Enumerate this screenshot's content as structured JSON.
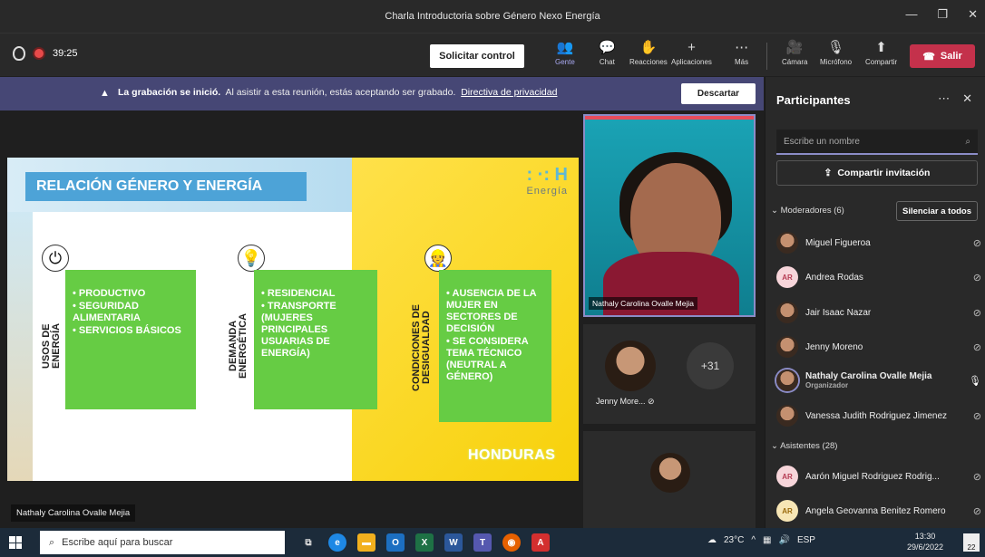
{
  "window": {
    "title": "Charla Introductoria sobre Género Nexo Energía",
    "minimize": "—",
    "restore": "❐",
    "close": "✕"
  },
  "toolbar": {
    "timer": "39:25",
    "request_control": "Solicitar control",
    "items": [
      {
        "label": "Gente",
        "icon": "people-icon",
        "glyph": "👥"
      },
      {
        "label": "Chat",
        "icon": "chat-icon",
        "glyph": "💬"
      },
      {
        "label": "Reacciones",
        "icon": "reactions-icon",
        "glyph": "✋"
      },
      {
        "label": "Aplicaciones",
        "icon": "plus-icon",
        "glyph": "+"
      },
      {
        "label": "Más",
        "icon": "more-icon",
        "glyph": "⋯"
      },
      {
        "label": "Cámara",
        "icon": "camera-off-icon",
        "glyph": "🎥"
      },
      {
        "label": "Micrófono",
        "icon": "mic-off-icon",
        "glyph": "🎙"
      },
      {
        "label": "Compartir",
        "icon": "share-icon",
        "glyph": "⬆"
      }
    ],
    "leave_label": "Salir"
  },
  "banner": {
    "bold": "La grabación se inició.",
    "text": "Al asistir a esta reunión, estás aceptando ser grabado.",
    "link": "Directiva de privacidad",
    "dismiss": "Descartar"
  },
  "slide": {
    "title": "RELACIÓN GÉNERO Y ENERGÍA",
    "logo_h": ": ·: H",
    "logo_sub": "Energía",
    "columns": [
      {
        "vlabel_1": "USOS DE",
        "vlabel_2": "ENERGÍA",
        "items": [
          "PRODUCTIVO",
          "SEGURIDAD ALIMENTARIA",
          "SERVICIOS BÁSICOS"
        ]
      },
      {
        "vlabel_1": "DEMANDA",
        "vlabel_2": "ENERGÉTICA",
        "items": [
          "RESIDENCIAL",
          "TRANSPORTE (MUJERES PRINCIPALES USUARIAS DE ENERGÍA)"
        ]
      },
      {
        "vlabel_1": "CONDICIONES DE",
        "vlabel_2": "DESIGUALDAD",
        "items": [
          "AUSENCIA DE LA MUJER EN SECTORES DE DECISIÓN",
          "SE CONSIDERA TEMA TÉCNICO (NEUTRAL A GÉNERO)"
        ]
      }
    ],
    "footer_brand": "HONDURAS"
  },
  "stage": {
    "presenter_label": "Nathaly Carolina Ovalle Mejia",
    "main_tile_name": "Nathaly Carolina Ovalle Mejia",
    "small_tile_name": "Jenny More...",
    "overflow_count": "+31"
  },
  "panel": {
    "title": "Participantes",
    "search_placeholder": "Escribe un nombre",
    "invite": "Compartir invitación",
    "moderators_header": "Moderadores (6)",
    "mute_all": "Silenciar a todos",
    "moderators": [
      {
        "name": "Miguel Figueroa",
        "avatar": "photo"
      },
      {
        "name": "Andrea Rodas",
        "avatar": "AR"
      },
      {
        "name": "Jair Isaac Nazar",
        "avatar": "photo"
      },
      {
        "name": "Jenny Moreno",
        "avatar": "photo"
      },
      {
        "name": "Nathaly Carolina Ovalle Mejia",
        "sub": "Organizador",
        "avatar": "photo",
        "mic": "on"
      },
      {
        "name": "Vanessa Judith Rodriguez Jimenez",
        "avatar": "photo"
      }
    ],
    "attendees_header": "Asistentes (28)",
    "attendees": [
      {
        "name": "Aarón Miguel Rodriguez Rodrig...",
        "avatar": "AR"
      },
      {
        "name": "Angela Geovanna Benitez Romero",
        "avatar": "AR"
      }
    ]
  },
  "taskbar": {
    "search_placeholder": "Escribe aquí para buscar",
    "temperature": "23°C",
    "language": "ESP",
    "time": "13:30",
    "date": "29/6/2022",
    "notifications": "22"
  }
}
